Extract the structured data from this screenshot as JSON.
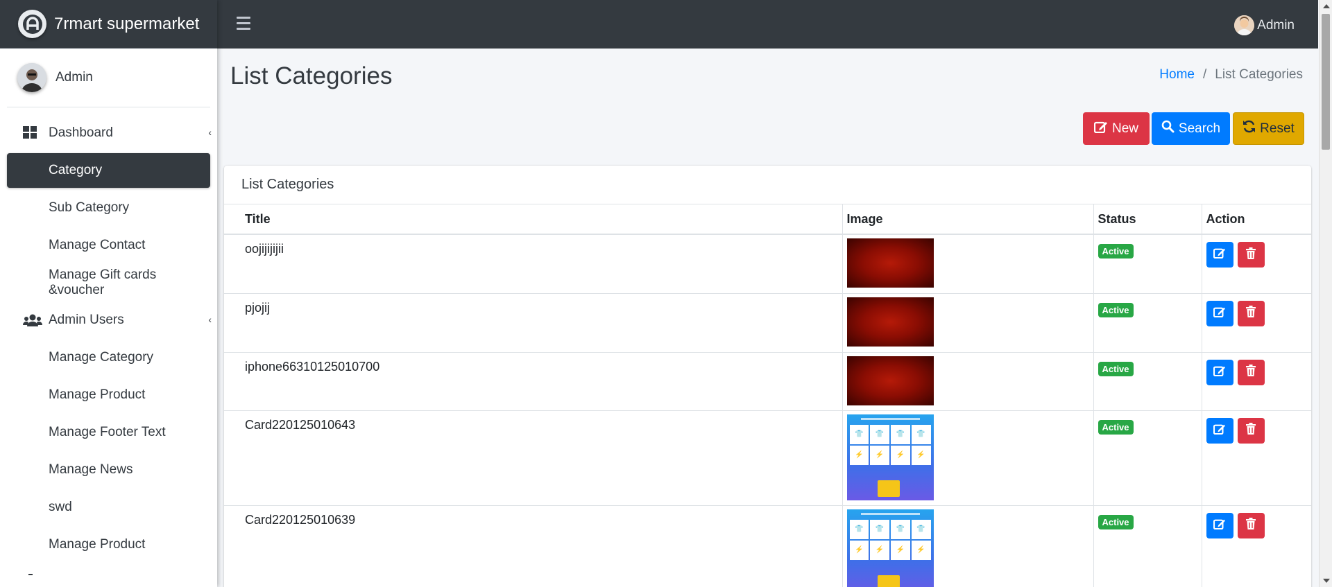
{
  "brand": {
    "name": "7rmart supermarket",
    "logo": "a-logo-icon"
  },
  "sidebar": {
    "user_name": "Admin",
    "items": [
      {
        "label": "Dashboard",
        "icon": "dashboard-icon",
        "has_caret": true
      },
      {
        "label": "Category",
        "active": true
      },
      {
        "label": "Sub Category"
      },
      {
        "label": "Manage Contact"
      },
      {
        "label": "Manage Gift cards &voucher"
      },
      {
        "label": "Admin Users",
        "icon": "users-icon",
        "has_caret": true
      },
      {
        "label": "Manage Category"
      },
      {
        "label": "Manage Product"
      },
      {
        "label": "Manage Footer Text"
      },
      {
        "label": "Manage News"
      },
      {
        "label": "swd"
      },
      {
        "label": "Manage Product"
      }
    ]
  },
  "topbar": {
    "user_name": "Admin"
  },
  "page": {
    "title": "List Categories",
    "breadcrumb": {
      "home": "Home",
      "separator": "/",
      "current": "List Categories"
    }
  },
  "toolbar": {
    "new_label": "New",
    "search_label": "Search",
    "reset_label": "Reset"
  },
  "card": {
    "title": "List Categories"
  },
  "table": {
    "headers": [
      "Title",
      "Image",
      "Status",
      "Action"
    ],
    "rows": [
      {
        "title": "oojijijijii",
        "image": "red-gradient",
        "status": "Active"
      },
      {
        "title": "pjojij",
        "image": "red-gradient",
        "status": "Active"
      },
      {
        "title": "iphone66310125010700",
        "image": "red-gradient",
        "status": "Active"
      },
      {
        "title": "Card220125010643",
        "image": "tshirt-card",
        "status": "Active"
      },
      {
        "title": "Card220125010639",
        "image": "tshirt-card",
        "status": "Active"
      }
    ]
  },
  "colors": {
    "navbar": "#343a40",
    "primary": "#007bff",
    "danger": "#dc3545",
    "warning": "#e0a800",
    "success": "#28a745"
  }
}
